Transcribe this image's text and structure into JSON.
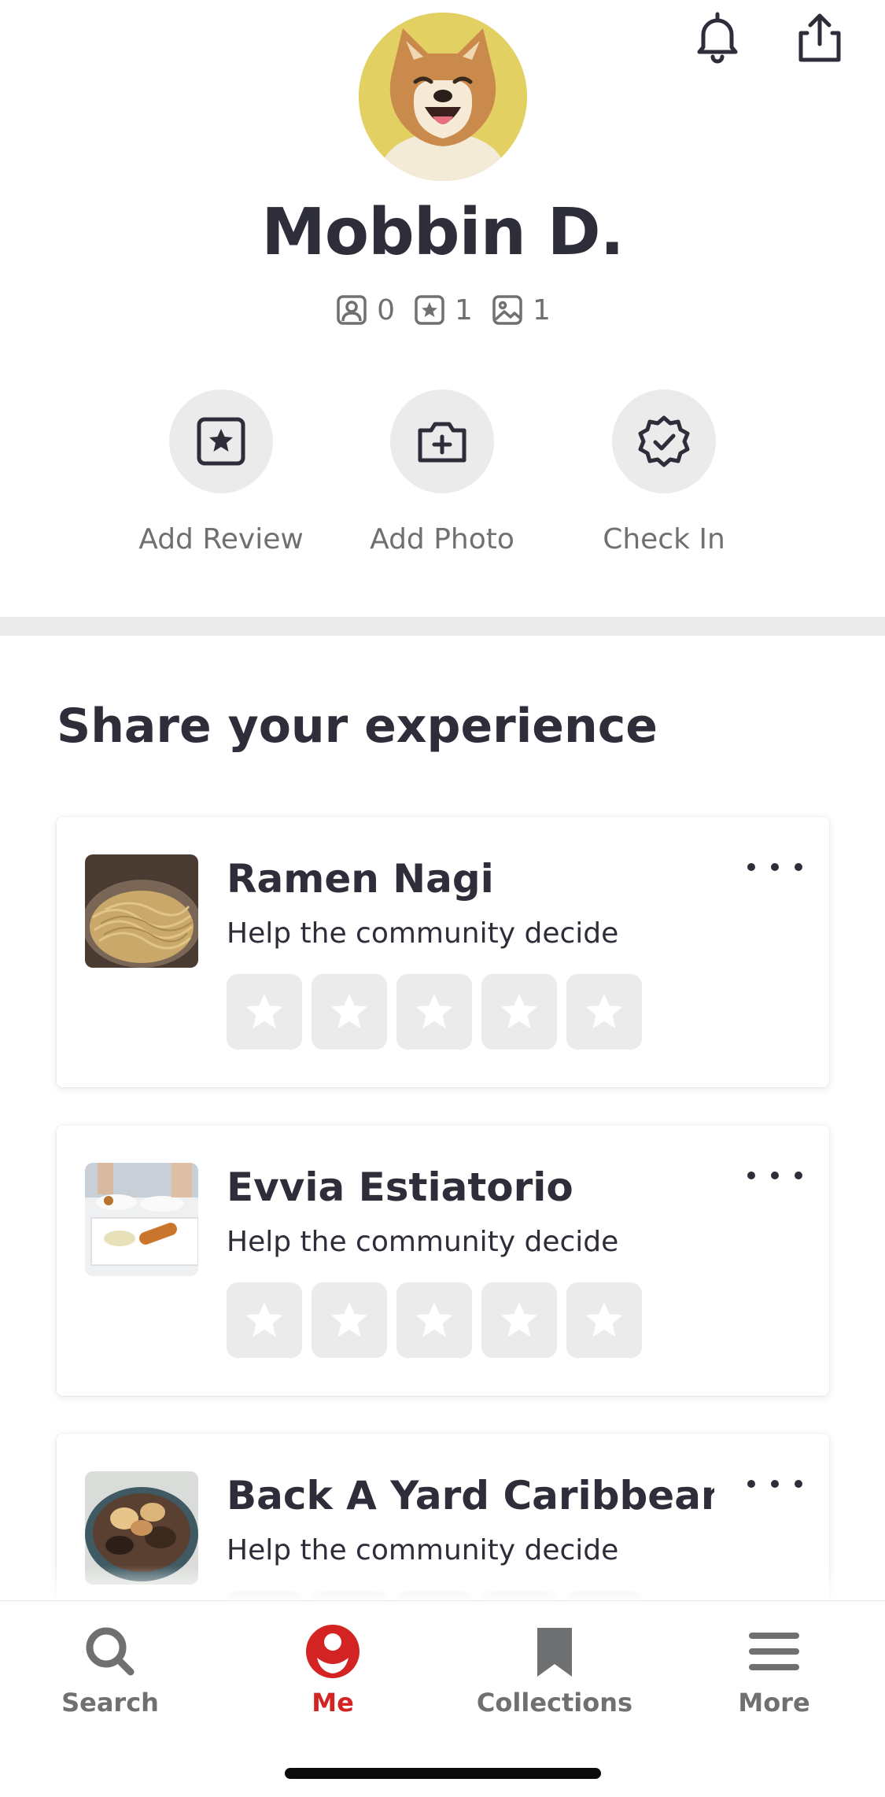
{
  "header": {
    "bell_icon": "bell-icon",
    "share_icon": "share-icon"
  },
  "profile": {
    "name": "Mobbin D.",
    "stats": {
      "friends": "0",
      "reviews": "1",
      "photos": "1"
    }
  },
  "actions": {
    "add_review": "Add Review",
    "add_photo": "Add Photo",
    "check_in": "Check In"
  },
  "section": {
    "title": "Share your experience"
  },
  "cards": [
    {
      "name": "Ramen Nagi",
      "subtitle": "Help the community decide"
    },
    {
      "name": "Evvia Estiatorio",
      "subtitle": "Help the community decide"
    },
    {
      "name": "Back A Yard Caribbean...",
      "subtitle": "Help the community decide"
    }
  ],
  "tabs": {
    "search": "Search",
    "me": "Me",
    "collections": "Collections",
    "more": "More"
  },
  "colors": {
    "accent": "#d32323",
    "text": "#2d2e3a",
    "muted": "#6e7072",
    "chip": "#ebebeb"
  }
}
